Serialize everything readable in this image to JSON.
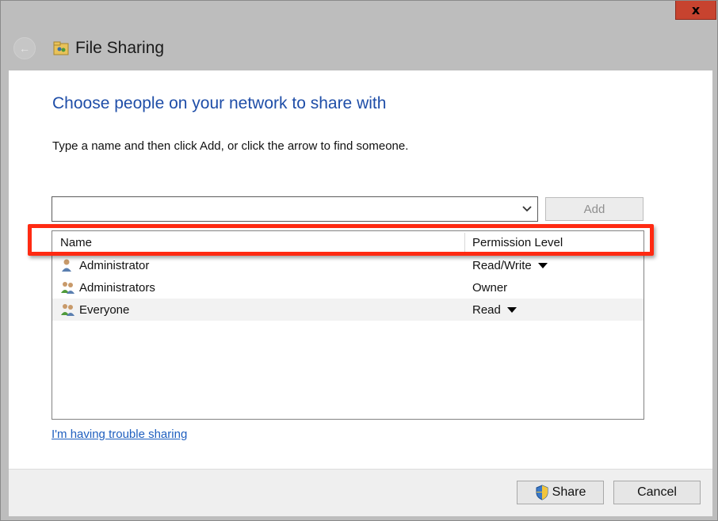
{
  "window": {
    "title": "File Sharing",
    "close_label": "x"
  },
  "main": {
    "heading": "Choose people on your network to share with",
    "instructions": "Type a name and then click Add, or click the arrow to find someone.",
    "name_input": {
      "value": "",
      "placeholder": ""
    },
    "add_label": "Add"
  },
  "list": {
    "columns": {
      "name": "Name",
      "permission": "Permission Level"
    },
    "rows": [
      {
        "name": "Administrator",
        "permission": "Read/Write",
        "icon": "user-icon",
        "has_dropdown": true
      },
      {
        "name": "Administrators",
        "permission": "Owner",
        "icon": "group-icon",
        "has_dropdown": false
      },
      {
        "name": "Everyone",
        "permission": "Read",
        "icon": "group-icon",
        "has_dropdown": true
      }
    ]
  },
  "footer": {
    "trouble_link": "I'm having trouble sharing",
    "share_label": "Share",
    "cancel_label": "Cancel"
  },
  "colors": {
    "heading": "#1f4ea8",
    "link": "#1f5fbf",
    "highlight": "#ff2a12",
    "close": "#c7432f"
  }
}
